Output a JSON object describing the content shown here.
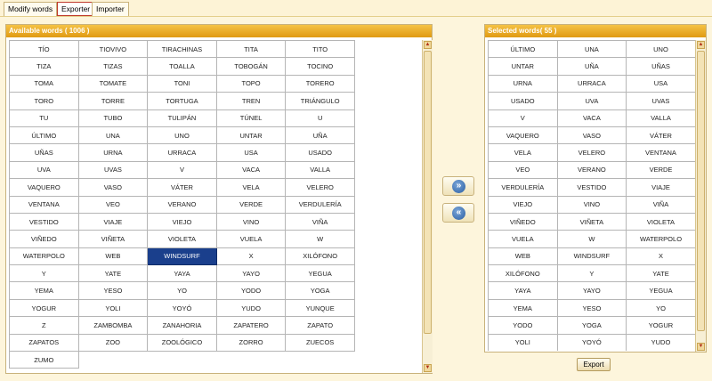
{
  "tabs": [
    {
      "label": "Modify words",
      "active": false
    },
    {
      "label": "Exporter",
      "active": true
    },
    {
      "label": "Importer",
      "active": false
    }
  ],
  "available": {
    "title": "Available words ( 1006 )",
    "selected_word": "WINDSURF",
    "rows": [
      [
        "TÍO",
        "TIOVIVO",
        "TIRACHINAS",
        "TITA",
        "TITO"
      ],
      [
        "TIZA",
        "TIZAS",
        "TOALLA",
        "TOBOGÁN",
        "TOCINO"
      ],
      [
        "TOMA",
        "TOMATE",
        "TONI",
        "TOPO",
        "TORERO"
      ],
      [
        "TORO",
        "TORRE",
        "TORTUGA",
        "TREN",
        "TRIÁNGULO"
      ],
      [
        "TU",
        "TUBO",
        "TULIPÁN",
        "TÚNEL",
        "U"
      ],
      [
        "ÚLTIMO",
        "UNA",
        "UNO",
        "UNTAR",
        "UÑA"
      ],
      [
        "UÑAS",
        "URNA",
        "URRACA",
        "USA",
        "USADO"
      ],
      [
        "UVA",
        "UVAS",
        "V",
        "VACA",
        "VALLA"
      ],
      [
        "VAQUERO",
        "VASO",
        "VÁTER",
        "VELA",
        "VELERO"
      ],
      [
        "VENTANA",
        "VEO",
        "VERANO",
        "VERDE",
        "VERDULERÍA"
      ],
      [
        "VESTIDO",
        "VIAJE",
        "VIEJO",
        "VINO",
        "VIÑA"
      ],
      [
        "VIÑEDO",
        "VIÑETA",
        "VIOLETA",
        "VUELA",
        "W"
      ],
      [
        "WATERPOLO",
        "WEB",
        "WINDSURF",
        "X",
        "XILÓFONO"
      ],
      [
        "Y",
        "YATE",
        "YAYA",
        "YAYO",
        "YEGUA"
      ],
      [
        "YEMA",
        "YESO",
        "YO",
        "YODO",
        "YOGA"
      ],
      [
        "YOGUR",
        "YOLI",
        "YOYÓ",
        "YUDO",
        "YUNQUE"
      ],
      [
        "Z",
        "ZAMBOMBA",
        "ZANAHORIA",
        "ZAPATERO",
        "ZAPATO"
      ],
      [
        "ZAPATOS",
        "ZOO",
        "ZOOLÓGICO",
        "ZORRO",
        "ZUECOS"
      ],
      [
        "ZUMO"
      ]
    ]
  },
  "selected": {
    "title": "Selected words( 55 )",
    "rows": [
      [
        "ÚLTIMO",
        "UNA",
        "UNO"
      ],
      [
        "UNTAR",
        "UÑA",
        "UÑAS"
      ],
      [
        "URNA",
        "URRACA",
        "USA"
      ],
      [
        "USADO",
        "UVA",
        "UVAS"
      ],
      [
        "V",
        "VACA",
        "VALLA"
      ],
      [
        "VAQUERO",
        "VASO",
        "VÁTER"
      ],
      [
        "VELA",
        "VELERO",
        "VENTANA"
      ],
      [
        "VEO",
        "VERANO",
        "VERDE"
      ],
      [
        "VERDULERÍA",
        "VESTIDO",
        "VIAJE"
      ],
      [
        "VIEJO",
        "VINO",
        "VIÑA"
      ],
      [
        "VIÑEDO",
        "VIÑETA",
        "VIOLETA"
      ],
      [
        "VUELA",
        "W",
        "WATERPOLO"
      ],
      [
        "WEB",
        "WINDSURF",
        "X"
      ],
      [
        "XILÓFONO",
        "Y",
        "YATE"
      ],
      [
        "YAYA",
        "YAYO",
        "YEGUA"
      ],
      [
        "YEMA",
        "YESO",
        "YO"
      ],
      [
        "YODO",
        "YOGA",
        "YOGUR"
      ],
      [
        "YOLI",
        "YOYÓ",
        "YUDO"
      ]
    ]
  },
  "buttons": {
    "add_icon": "double-chevron-right-icon",
    "remove_icon": "double-chevron-left-icon",
    "add_glyph": "»",
    "remove_glyph": "«",
    "export_label": "Export"
  },
  "scroll_icons": {
    "up": "scroll-up-icon",
    "down": "scroll-down-icon",
    "up_glyph": "▲",
    "down_glyph": "▼"
  },
  "colors": {
    "header": "#e9a923",
    "selection": "#1a3f8c",
    "background": "#fdf5dc"
  }
}
